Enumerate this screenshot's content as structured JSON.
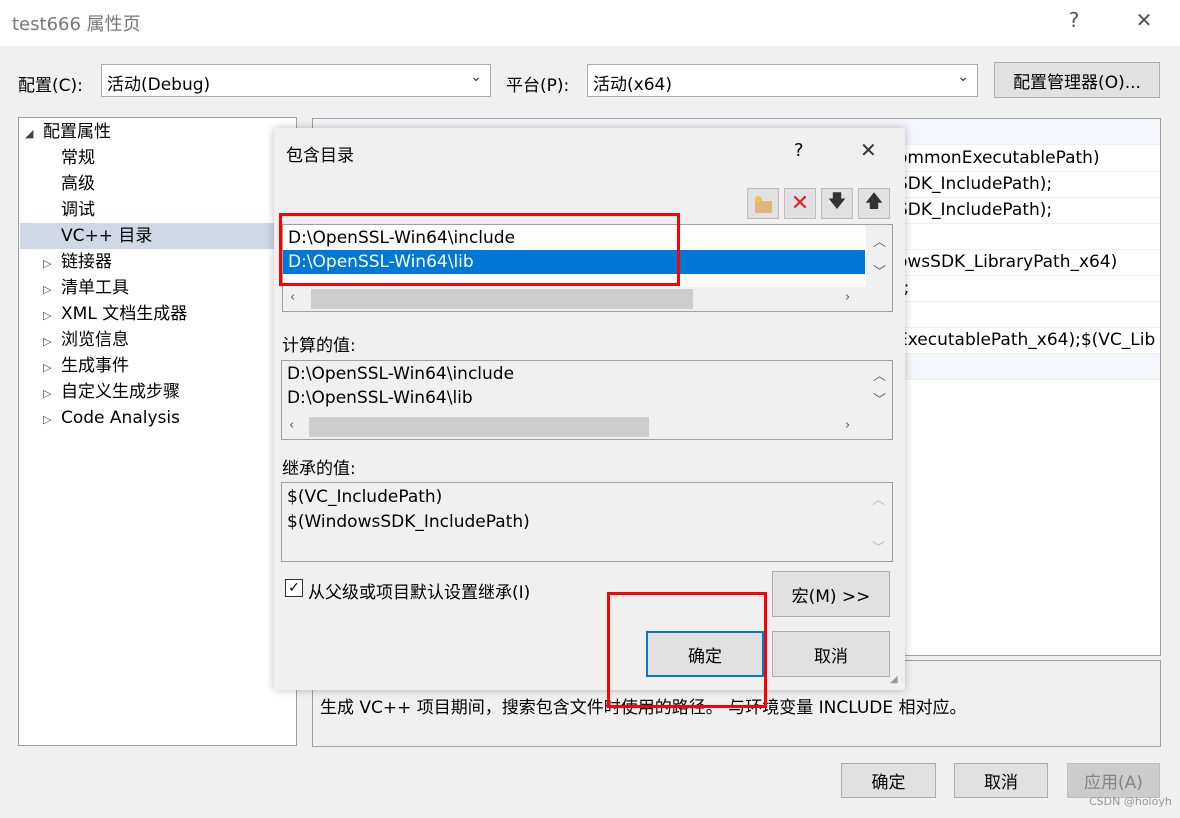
{
  "window": {
    "title": "test666 属性页",
    "help": "?",
    "close": "✕"
  },
  "config": {
    "config_label": "配置(C):",
    "config_value": "活动(Debug)",
    "platform_label": "平台(P):",
    "platform_value": "活动(x64)",
    "manager_button": "配置管理器(O)..."
  },
  "tree": {
    "root": "配置属性",
    "items": [
      {
        "label": "常规",
        "expandable": false
      },
      {
        "label": "高级",
        "expandable": false
      },
      {
        "label": "调试",
        "expandable": false
      },
      {
        "label": "VC++ 目录",
        "expandable": false,
        "selected": true
      },
      {
        "label": "链接器",
        "expandable": true
      },
      {
        "label": "清单工具",
        "expandable": true
      },
      {
        "label": "XML 文档生成器",
        "expandable": true
      },
      {
        "label": "浏览信息",
        "expandable": true
      },
      {
        "label": "生成事件",
        "expandable": true
      },
      {
        "label": "自定义生成步骤",
        "expandable": true
      },
      {
        "label": "Code Analysis",
        "expandable": true
      }
    ]
  },
  "property_grid": {
    "rows": [
      "ommonExecutablePath)",
      "SDK_IncludePath);",
      "SDK_IncludePath);",
      "",
      "owsSDK_LibraryPath_x64)",
      ");",
      "",
      "ExecutablePath_x64);$(VC_Lib"
    ]
  },
  "description": "生成 VC++ 项目期间，搜索包含文件时使用的路径。 与环境变量 INCLUDE 相对应。",
  "buttons": {
    "ok": "确定",
    "cancel": "取消",
    "apply": "应用(A)"
  },
  "dialog": {
    "title": "包含目录",
    "help": "?",
    "close": "✕",
    "toolbar": [
      {
        "icon": "new-folder-icon"
      },
      {
        "icon": "delete-icon"
      },
      {
        "icon": "move-down-icon"
      },
      {
        "icon": "move-up-icon"
      }
    ],
    "entries": [
      "D:\\OpenSSL-Win64\\include",
      "D:\\OpenSSL-Win64\\lib"
    ],
    "selected_index": 1,
    "evaluated_label": "计算的值:",
    "evaluated": [
      "D:\\OpenSSL-Win64\\include",
      "D:\\OpenSSL-Win64\\lib"
    ],
    "inherited_label": "继承的值:",
    "inherited": [
      "$(VC_IncludePath)",
      "$(WindowsSDK_IncludePath)"
    ],
    "inherit_checkbox": "从父级或项目默认设置继承(I)",
    "inherit_checked": true,
    "macros_button": "宏(M) >>",
    "ok": "确定",
    "cancel": "取消"
  },
  "watermark": "CSDN @holoyh",
  "colors": {
    "selection": "#0078d7",
    "highlight": "#ff0000"
  }
}
